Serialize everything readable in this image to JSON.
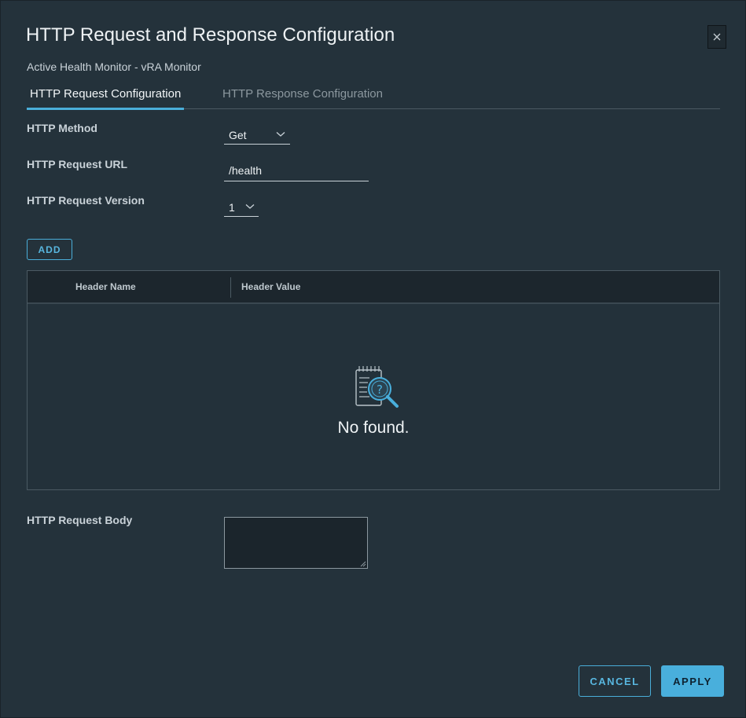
{
  "dialog": {
    "title": "HTTP Request and Response Configuration",
    "subtitle": "Active Health Monitor - vRA Monitor",
    "close_icon": "close-icon"
  },
  "tabs": [
    {
      "label": "HTTP Request Configuration",
      "active": true
    },
    {
      "label": "HTTP Response Configuration",
      "active": false
    }
  ],
  "form": {
    "method": {
      "label": "HTTP Method",
      "value": "Get"
    },
    "url": {
      "label": "HTTP Request URL",
      "value": "/health"
    },
    "version": {
      "label": "HTTP Request Version",
      "value": "1"
    },
    "body": {
      "label": "HTTP Request Body",
      "value": ""
    }
  },
  "headers_table": {
    "add_label": "ADD",
    "columns": [
      "Header Name",
      "Header Value"
    ],
    "rows": [],
    "empty_text": "No found.",
    "empty_icon": "search-document-icon"
  },
  "footer": {
    "cancel_label": "CANCEL",
    "apply_label": "APPLY"
  },
  "colors": {
    "accent": "#49afdc",
    "background": "#24323b"
  }
}
